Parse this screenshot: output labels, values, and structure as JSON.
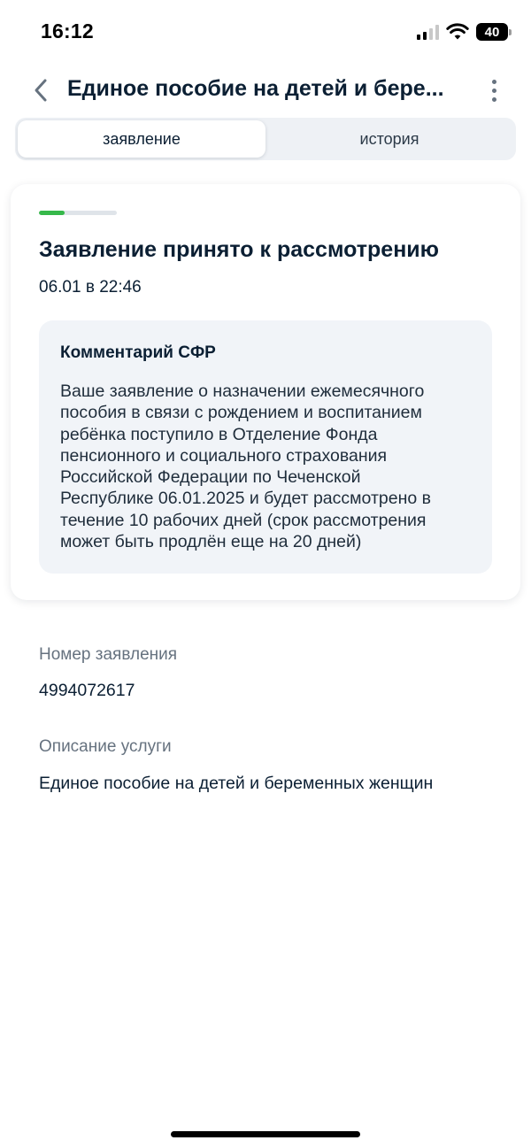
{
  "status_bar": {
    "time": "16:12",
    "battery_level": "40",
    "icons": [
      "signal-icon",
      "wifi-icon",
      "battery-icon"
    ]
  },
  "header": {
    "title": "Единое пособие на детей и бере...",
    "back_icon": "chevron-left-icon",
    "more_icon": "more-vertical-icon"
  },
  "tabs": [
    {
      "label": "заявление",
      "active": true
    },
    {
      "label": "история",
      "active": false
    }
  ],
  "status_card": {
    "progress": 0.33,
    "progress_color": "#36b84a",
    "title": "Заявление принято к рассмотрению",
    "date": "06.01 в 22:46",
    "comment": {
      "title": "Комментарий СФР",
      "lines": [
        "Ваше заявление о назначении ежемесячного",
        "пособия в связи с рождением и воспитанием",
        "ребёнка поступило в Отделение Фонда",
        "пенсионного и социального страхования",
        "Российской Федерации по Чеченской",
        "Республике 06.01.2025 и будет рассмотрено в",
        "течение 10 рабочих дней (срок рассмотрения",
        "может быть продлён еще на 20 дней)"
      ]
    }
  },
  "details": {
    "application_number_label": "Номер заявления",
    "application_number": "4994072617",
    "service_description_label": "Описание услуги",
    "service_description": "Единое пособие на детей и беременных женщин"
  },
  "colors": {
    "text_primary": "#0b1f33",
    "text_secondary": "#66727f",
    "accent_green": "#36b84a",
    "tab_background": "#eef1f5",
    "comment_background": "#f1f4f8"
  }
}
